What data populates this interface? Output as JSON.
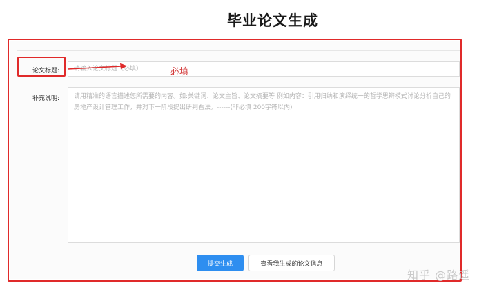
{
  "page": {
    "title": "毕业论文生成"
  },
  "form": {
    "title_label": "论文标题:",
    "title_placeholder": "请输入论文标题（必填）",
    "required_note": "必填",
    "extra_label": "补充说明:",
    "extra_placeholder": "请用精准的语言描述您所需要的内容。如:关键词、论文主旨、论文摘要等 例如内容：引用归纳和演绎统一的哲学思辨模式讨论分析自己的房地产设计管理工作，并对下一阶段提出研判看法。------(非必填 200字符以内)"
  },
  "actions": {
    "submit_label": "提交生成",
    "view_label": "查看我生成的论文信息"
  },
  "watermark": {
    "text": "知乎 @路遥"
  },
  "colors": {
    "annotation_red": "#e02a2a",
    "primary_blue": "#2e8ef0"
  }
}
